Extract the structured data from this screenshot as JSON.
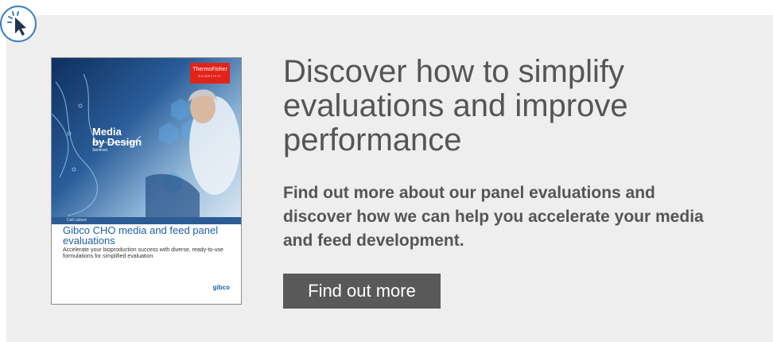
{
  "promo": {
    "headline": "Discover how to simplify evaluations and improve performance",
    "description": "Find out more about our panel evaluations and discover how we can help you accelerate your media and feed development.",
    "cta_label": "Find out more"
  },
  "brochure": {
    "brand_line1": "ThermoFisher",
    "brand_line2": "SCIENTIFIC",
    "art_title_line1": "Media",
    "art_title_line2": "by Design",
    "art_title_sub": "Services",
    "category": "Cell culture",
    "title": "Gibco CHO media and feed panel evaluations",
    "subtitle": "Accelerate your bioproduction success with diverse, ready-to-use formulations for simplified evaluation",
    "logo": "gibco"
  },
  "icons": {
    "cursor_badge": "click-cursor-icon"
  },
  "colors": {
    "panel_bg": "#eeeeee",
    "text_gray": "#555555",
    "button_bg": "#595959",
    "brand_red": "#e2231a",
    "brand_blue": "#1e5ea8",
    "badge_border": "#3a7fc1"
  }
}
